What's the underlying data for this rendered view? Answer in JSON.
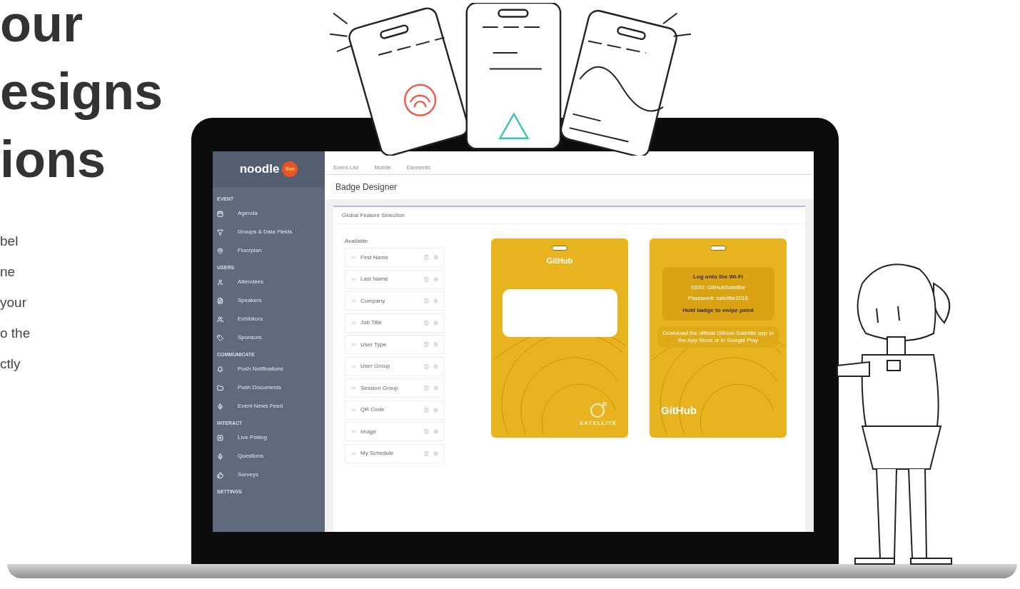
{
  "intro": {
    "heading_lines": [
      "our",
      "esigns",
      "ions"
    ],
    "paragraph_lines": [
      "bel",
      "ne",
      "your",
      "o the",
      "ctly"
    ]
  },
  "app": {
    "logo": {
      "word": "noodle",
      "badge": "live"
    },
    "nav_tabs": [
      "Event List",
      "Mobile",
      "Elements"
    ],
    "sidebar": [
      {
        "title": "EVENT",
        "items": [
          "Agenda",
          "Groups & Data Fields",
          "Floorplan"
        ]
      },
      {
        "title": "USERS",
        "items": [
          "Attendees",
          "Speakers",
          "Exhibitors",
          "Sponsors"
        ]
      },
      {
        "title": "COMMUNICATE",
        "items": [
          "Push Notifications",
          "Push Documents",
          "Event News Feed"
        ]
      },
      {
        "title": "INTERACT",
        "items": [
          "Live Polling",
          "Questions",
          "Surveys"
        ]
      },
      {
        "title": "SETTINGS"
      }
    ],
    "page_title": "Badge Designer",
    "panel_title": "Global Feature Selection",
    "available_label": "Available",
    "fields": [
      "First Name",
      "Last Name",
      "Company",
      "Job Title",
      "User Type",
      "User Group",
      "Session Group",
      "QR Code",
      "Image",
      "My Schedule"
    ],
    "badges": [
      {
        "kind": "front",
        "brand": "GitHub",
        "logo_text": "SATELLITE"
      },
      {
        "kind": "back",
        "wifi_title": "Log onto the Wi-Fi",
        "wifi_lines": [
          "SSID: GitHubSatellite",
          "Password: satellite2016"
        ],
        "wifi_note": "Hold badge to swipe point",
        "app_note": "Download the official GitHub Satellite app in the App Store or in Google Play",
        "brand": "GitHub"
      }
    ]
  }
}
